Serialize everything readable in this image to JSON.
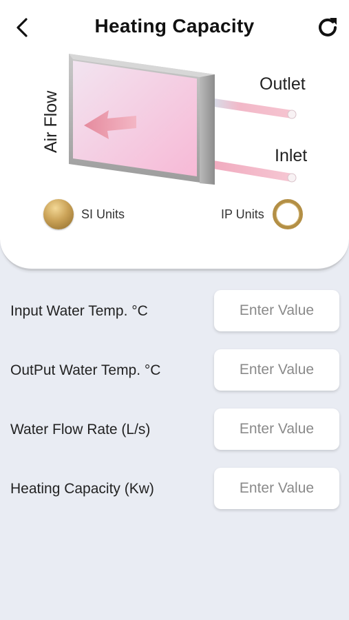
{
  "header": {
    "title": "Heating Capacity",
    "back_icon": "chevron-left-icon",
    "refresh_icon": "refresh-icon"
  },
  "diagram": {
    "outlet_label": "Outlet",
    "inlet_label": "Inlet",
    "airflow_label": "Air Flow"
  },
  "units": {
    "si_label": "SI Units",
    "ip_label": "IP Units",
    "selected": "SI Units",
    "accent_color": "#b38f45"
  },
  "form": {
    "fields": [
      {
        "label": "Input Water Temp. °C",
        "placeholder": "Enter Value",
        "value": ""
      },
      {
        "label": "OutPut Water Temp. °C",
        "placeholder": "Enter Value",
        "value": ""
      },
      {
        "label": "Water Flow Rate (L/s)",
        "placeholder": "Enter Value",
        "value": ""
      },
      {
        "label": "Heating Capacity (Kw)",
        "placeholder": "Enter Value",
        "value": ""
      }
    ]
  },
  "colors": {
    "background": "#e9ecf3",
    "card": "#ffffff"
  }
}
